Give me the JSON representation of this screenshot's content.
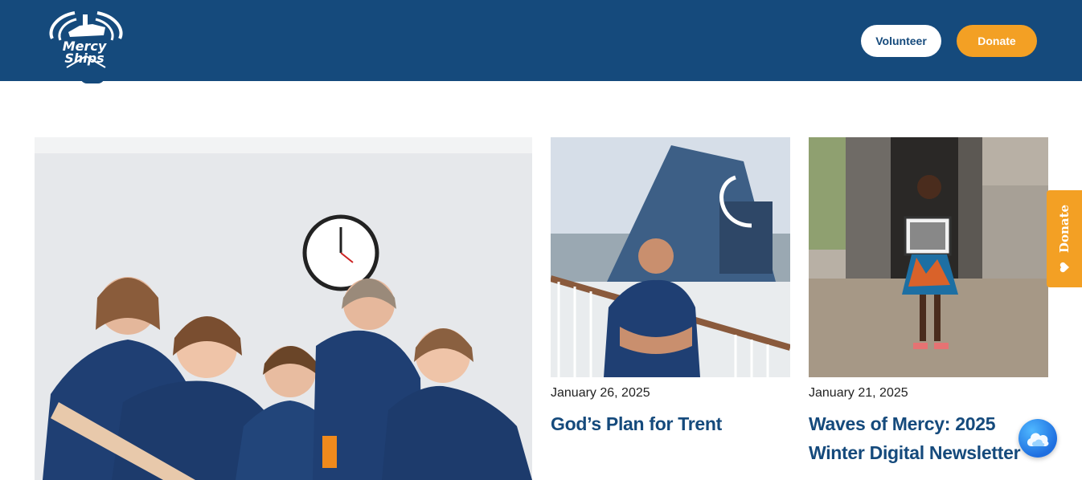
{
  "header": {
    "logo_text_line1": "Mercy",
    "logo_text_line2": "Ships",
    "volunteer_label": "Volunteer",
    "donate_label": "Donate"
  },
  "colors": {
    "brand_blue": "#154a7c",
    "accent_orange": "#f3a024"
  },
  "posts": [
    {
      "date": "January 26, 2025",
      "title": "God’s Plan for Trent",
      "image_icon": "photo-crew-member-ship"
    },
    {
      "date": "January 21, 2025",
      "title": "Waves of Mercy: 2025 Winter Digital Newsletter",
      "image_icon": "photo-girl-holding-picture"
    }
  ],
  "featured_image_icon": "photo-medical-team",
  "side_tab": {
    "label": "Donate",
    "icon": "heart-icon"
  },
  "chat": {
    "icon": "chat-cloud-icon"
  }
}
